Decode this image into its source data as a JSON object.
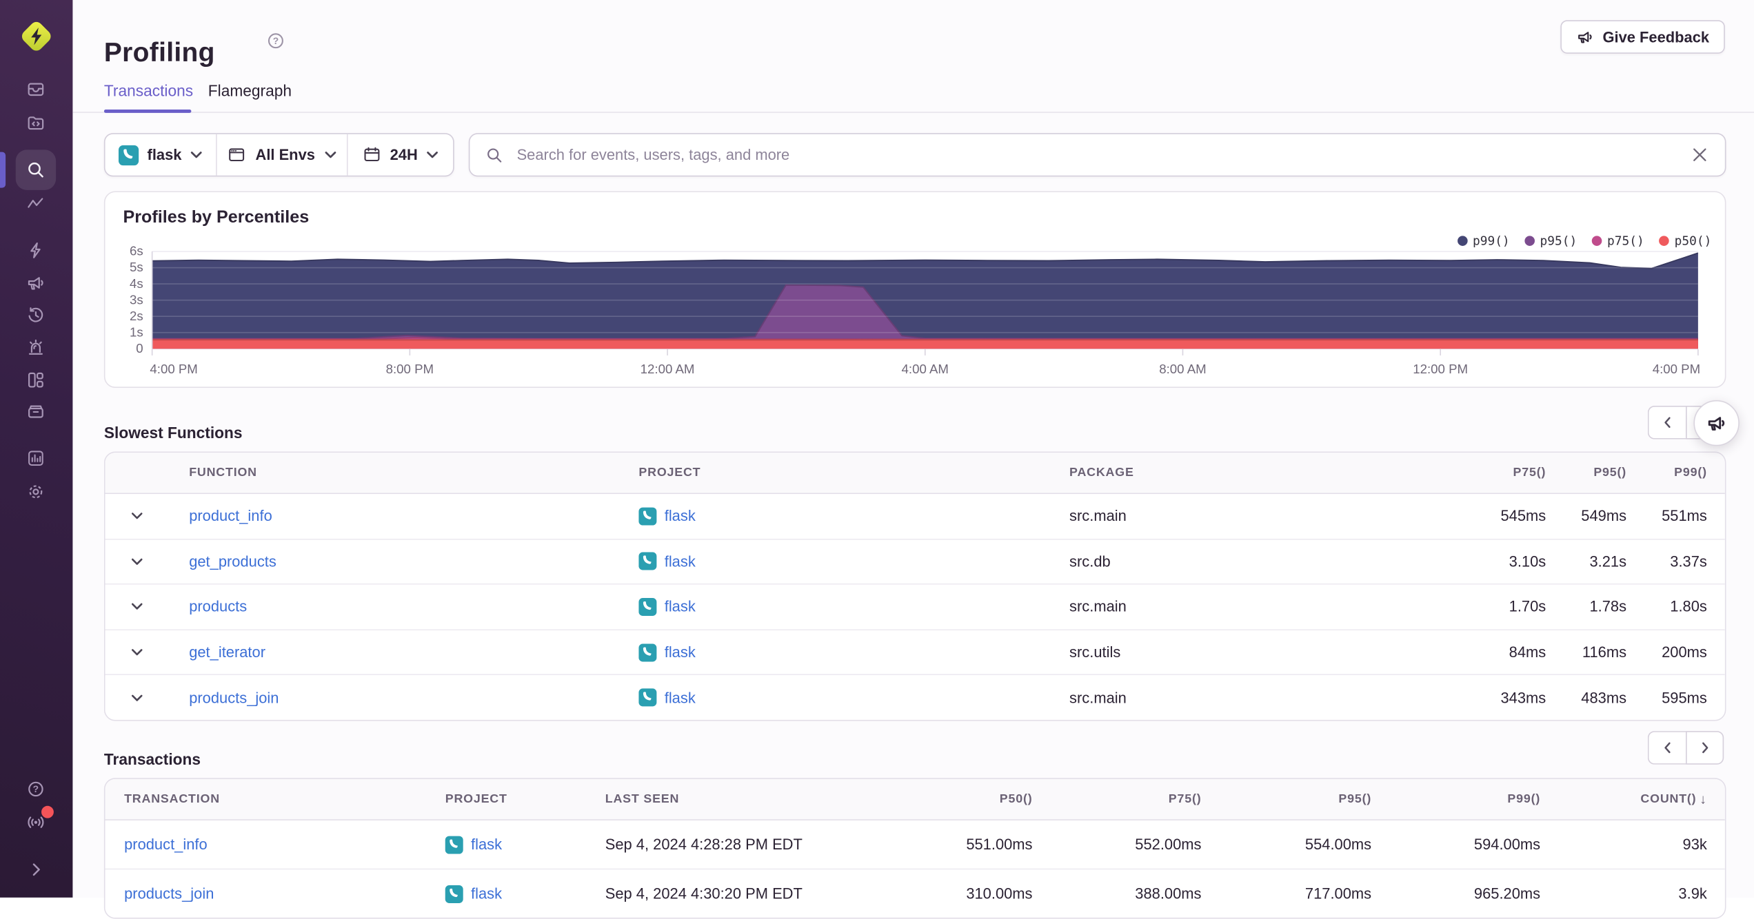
{
  "page": {
    "title": "Profiling",
    "help_icon": "question-circle",
    "give_feedback_label": "Give Feedback"
  },
  "tabs": [
    {
      "label": "Transactions",
      "active": true
    },
    {
      "label": "Flamegraph",
      "active": false
    }
  ],
  "filters": {
    "project": {
      "label": "flask",
      "icon": "flask-project"
    },
    "environment": {
      "label": "All Envs",
      "icon": "window"
    },
    "date_range": {
      "label": "24H",
      "icon": "calendar"
    }
  },
  "search": {
    "placeholder": "Search for events, users, tags, and more",
    "icon": "magnifier",
    "clear_icon": "x"
  },
  "chart_data": {
    "type": "area",
    "title": "Profiles by Percentiles",
    "legend_position": "top-right",
    "grid": true,
    "x_ticks": [
      "4:00 PM",
      "8:00 PM",
      "12:00 AM",
      "4:00 AM",
      "8:00 AM",
      "12:00 PM",
      "4:00 PM"
    ],
    "y_ticks": [
      "0",
      "1s",
      "2s",
      "3s",
      "4s",
      "5s",
      "6s"
    ],
    "y_max_seconds": 6,
    "series": [
      {
        "name": "p99()",
        "color": "#444674",
        "points": [
          [
            0,
            5.42
          ],
          [
            0.03,
            5.46
          ],
          [
            0.06,
            5.43
          ],
          [
            0.09,
            5.4
          ],
          [
            0.12,
            5.52
          ],
          [
            0.15,
            5.47
          ],
          [
            0.18,
            5.38
          ],
          [
            0.2,
            5.44
          ],
          [
            0.23,
            5.52
          ],
          [
            0.25,
            5.45
          ],
          [
            0.27,
            5.28
          ],
          [
            0.3,
            5.33
          ],
          [
            0.33,
            5.4
          ],
          [
            0.37,
            5.46
          ],
          [
            0.41,
            5.44
          ],
          [
            0.45,
            5.43
          ],
          [
            0.5,
            5.47
          ],
          [
            0.54,
            5.44
          ],
          [
            0.58,
            5.43
          ],
          [
            0.62,
            5.49
          ],
          [
            0.65,
            5.52
          ],
          [
            0.69,
            5.45
          ],
          [
            0.72,
            5.36
          ],
          [
            0.76,
            5.43
          ],
          [
            0.8,
            5.46
          ],
          [
            0.84,
            5.44
          ],
          [
            0.87,
            5.49
          ],
          [
            0.9,
            5.44
          ],
          [
            0.93,
            5.3
          ],
          [
            0.95,
            5.02
          ],
          [
            0.97,
            4.95
          ],
          [
            1,
            5.9
          ]
        ]
      },
      {
        "name": "p95()",
        "color": "#7c4c8f",
        "points": [
          [
            0,
            0.63
          ],
          [
            0.13,
            0.63
          ],
          [
            0.165,
            0.82
          ],
          [
            0.2,
            0.66
          ],
          [
            0.25,
            0.63
          ],
          [
            0.37,
            0.63
          ],
          [
            0.39,
            0.75
          ],
          [
            0.41,
            3.93
          ],
          [
            0.445,
            3.9
          ],
          [
            0.46,
            3.8
          ],
          [
            0.485,
            0.8
          ],
          [
            0.5,
            0.64
          ],
          [
            0.75,
            0.63
          ],
          [
            1,
            0.64
          ]
        ]
      },
      {
        "name": "p75()",
        "color": "#c04c8c",
        "points": [
          [
            0,
            0.59
          ],
          [
            0.14,
            0.59
          ],
          [
            0.17,
            0.68
          ],
          [
            0.2,
            0.6
          ],
          [
            0.5,
            0.59
          ],
          [
            1,
            0.59
          ]
        ]
      },
      {
        "name": "p50()",
        "color": "#ef5a5d",
        "points": [
          [
            0,
            0.55
          ],
          [
            0.3,
            0.54
          ],
          [
            0.6,
            0.55
          ],
          [
            1,
            0.55
          ]
        ]
      }
    ]
  },
  "slowest_functions": {
    "heading": "Slowest Functions",
    "columns": [
      "FUNCTION",
      "PROJECT",
      "PACKAGE",
      "P75()",
      "P95()",
      "P99()"
    ],
    "rows": [
      {
        "function": "product_info",
        "project": "flask",
        "package": "src.main",
        "p75": "545ms",
        "p95": "549ms",
        "p99": "551ms"
      },
      {
        "function": "get_products",
        "project": "flask",
        "package": "src.db",
        "p75": "3.10s",
        "p95": "3.21s",
        "p99": "3.37s"
      },
      {
        "function": "products",
        "project": "flask",
        "package": "src.main",
        "p75": "1.70s",
        "p95": "1.78s",
        "p99": "1.80s"
      },
      {
        "function": "get_iterator",
        "project": "flask",
        "package": "src.utils",
        "p75": "84ms",
        "p95": "116ms",
        "p99": "200ms"
      },
      {
        "function": "products_join",
        "project": "flask",
        "package": "src.main",
        "p75": "343ms",
        "p95": "483ms",
        "p99": "595ms"
      }
    ]
  },
  "transactions": {
    "heading": "Transactions",
    "columns": [
      "TRANSACTION",
      "PROJECT",
      "LAST SEEN",
      "P50()",
      "P75()",
      "P95()",
      "P99()",
      "COUNT()"
    ],
    "sort_indicator": "↓",
    "rows": [
      {
        "transaction": "product_info",
        "project": "flask",
        "last_seen": "Sep 4, 2024 4:28:28 PM EDT",
        "p50": "551.00ms",
        "p75": "552.00ms",
        "p95": "554.00ms",
        "p99": "594.00ms",
        "count": "93k"
      },
      {
        "transaction": "products_join",
        "project": "flask",
        "last_seen": "Sep 4, 2024 4:30:20 PM EDT",
        "p50": "310.00ms",
        "p75": "388.00ms",
        "p95": "717.00ms",
        "p99": "965.20ms",
        "count": "3.9k"
      }
    ]
  },
  "sidebar": {
    "logo": "sentry-logo",
    "active_item": "search",
    "icons": [
      "issues",
      "projects-code",
      "search",
      "metrics",
      "lightning",
      "feedback-megaphone",
      "replays",
      "alerts",
      "dashboards",
      "releases",
      "stats",
      "settings"
    ],
    "footer_icons": [
      "help",
      "whats-new-broadcast",
      "collapse-chevron"
    ],
    "notification_color": "#f55459"
  },
  "colors": {
    "accent_purple": "#6a5ec9",
    "link_blue": "#3c6fd6",
    "project_teal": "#2a9fb1",
    "p99": "#444674",
    "p95": "#7c4c8f",
    "p75": "#c04c8c",
    "p50": "#ef5a5d"
  }
}
